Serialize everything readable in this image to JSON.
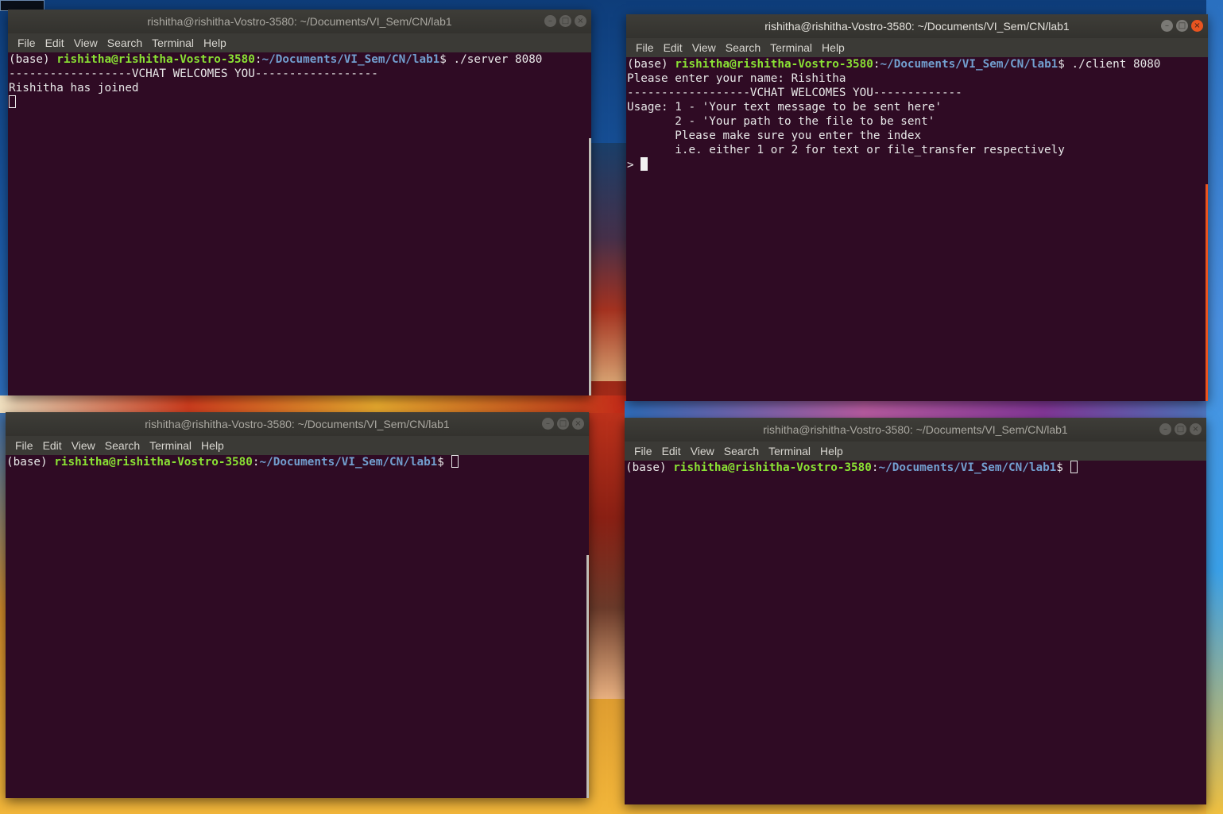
{
  "menu": [
    "File",
    "Edit",
    "View",
    "Search",
    "Terminal",
    "Help"
  ],
  "windows": [
    {
      "title": "rishitha@rishitha-Vostro-3580: ~/Documents/VI_Sem/CN/lab1",
      "prompt": {
        "prefix": "(base) ",
        "user": "rishitha@rishitha-Vostro-3580",
        "sep": ":",
        "path": "~/Documents/VI_Sem/CN/lab1",
        "suffix": "$ ",
        "command": "./server 8080"
      },
      "output": [
        "------------------VCHAT WELCOMES YOU------------------",
        "Rishitha has joined"
      ]
    },
    {
      "title": "rishitha@rishitha-Vostro-3580: ~/Documents/VI_Sem/CN/lab1",
      "prompt": {
        "prefix": "(base) ",
        "user": "rishitha@rishitha-Vostro-3580",
        "sep": ":",
        "path": "~/Documents/VI_Sem/CN/lab1",
        "suffix": "$ ",
        "command": "./client 8080"
      },
      "output": [
        "Please enter your name: Rishitha",
        "------------------VCHAT WELCOMES YOU-------------",
        "Usage: 1 - 'Your text message to be sent here'",
        "       2 - 'Your path to the file to be sent'",
        "       Please make sure you enter the index",
        "       i.e. either 1 or 2 for text or file_transfer respectively"
      ],
      "input_prompt": "> "
    },
    {
      "title": "rishitha@rishitha-Vostro-3580: ~/Documents/VI_Sem/CN/lab1",
      "prompt": {
        "prefix": "(base) ",
        "user": "rishitha@rishitha-Vostro-3580",
        "sep": ":",
        "path": "~/Documents/VI_Sem/CN/lab1",
        "suffix": "$ ",
        "command": ""
      }
    },
    {
      "title": "rishitha@rishitha-Vostro-3580: ~/Documents/VI_Sem/CN/lab1",
      "prompt": {
        "prefix": "(base) ",
        "user": "rishitha@rishitha-Vostro-3580",
        "sep": ":",
        "path": "~/Documents/VI_Sem/CN/lab1",
        "suffix": "$ ",
        "command": ""
      }
    }
  ],
  "colors": {
    "terminal_bg": "#2f0b24",
    "prompt_user": "#8ae234",
    "prompt_path": "#729fcf",
    "close_active": "#e95420"
  }
}
